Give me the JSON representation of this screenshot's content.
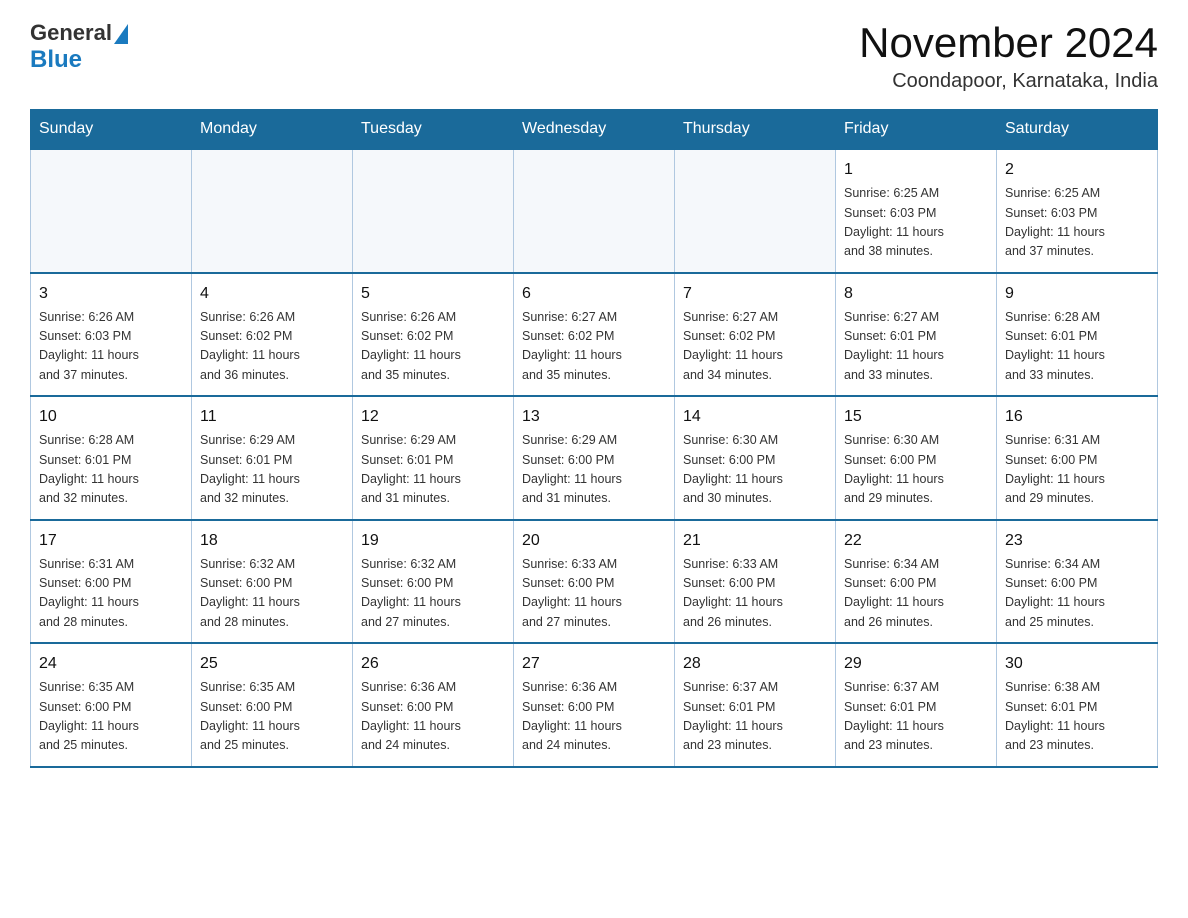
{
  "header": {
    "logo_general": "General",
    "logo_blue": "Blue",
    "title": "November 2024",
    "subtitle": "Coondapoor, Karnataka, India"
  },
  "days_of_week": [
    "Sunday",
    "Monday",
    "Tuesday",
    "Wednesday",
    "Thursday",
    "Friday",
    "Saturday"
  ],
  "weeks": [
    [
      {
        "day": "",
        "info": ""
      },
      {
        "day": "",
        "info": ""
      },
      {
        "day": "",
        "info": ""
      },
      {
        "day": "",
        "info": ""
      },
      {
        "day": "",
        "info": ""
      },
      {
        "day": "1",
        "info": "Sunrise: 6:25 AM\nSunset: 6:03 PM\nDaylight: 11 hours\nand 38 minutes."
      },
      {
        "day": "2",
        "info": "Sunrise: 6:25 AM\nSunset: 6:03 PM\nDaylight: 11 hours\nand 37 minutes."
      }
    ],
    [
      {
        "day": "3",
        "info": "Sunrise: 6:26 AM\nSunset: 6:03 PM\nDaylight: 11 hours\nand 37 minutes."
      },
      {
        "day": "4",
        "info": "Sunrise: 6:26 AM\nSunset: 6:02 PM\nDaylight: 11 hours\nand 36 minutes."
      },
      {
        "day": "5",
        "info": "Sunrise: 6:26 AM\nSunset: 6:02 PM\nDaylight: 11 hours\nand 35 minutes."
      },
      {
        "day": "6",
        "info": "Sunrise: 6:27 AM\nSunset: 6:02 PM\nDaylight: 11 hours\nand 35 minutes."
      },
      {
        "day": "7",
        "info": "Sunrise: 6:27 AM\nSunset: 6:02 PM\nDaylight: 11 hours\nand 34 minutes."
      },
      {
        "day": "8",
        "info": "Sunrise: 6:27 AM\nSunset: 6:01 PM\nDaylight: 11 hours\nand 33 minutes."
      },
      {
        "day": "9",
        "info": "Sunrise: 6:28 AM\nSunset: 6:01 PM\nDaylight: 11 hours\nand 33 minutes."
      }
    ],
    [
      {
        "day": "10",
        "info": "Sunrise: 6:28 AM\nSunset: 6:01 PM\nDaylight: 11 hours\nand 32 minutes."
      },
      {
        "day": "11",
        "info": "Sunrise: 6:29 AM\nSunset: 6:01 PM\nDaylight: 11 hours\nand 32 minutes."
      },
      {
        "day": "12",
        "info": "Sunrise: 6:29 AM\nSunset: 6:01 PM\nDaylight: 11 hours\nand 31 minutes."
      },
      {
        "day": "13",
        "info": "Sunrise: 6:29 AM\nSunset: 6:00 PM\nDaylight: 11 hours\nand 31 minutes."
      },
      {
        "day": "14",
        "info": "Sunrise: 6:30 AM\nSunset: 6:00 PM\nDaylight: 11 hours\nand 30 minutes."
      },
      {
        "day": "15",
        "info": "Sunrise: 6:30 AM\nSunset: 6:00 PM\nDaylight: 11 hours\nand 29 minutes."
      },
      {
        "day": "16",
        "info": "Sunrise: 6:31 AM\nSunset: 6:00 PM\nDaylight: 11 hours\nand 29 minutes."
      }
    ],
    [
      {
        "day": "17",
        "info": "Sunrise: 6:31 AM\nSunset: 6:00 PM\nDaylight: 11 hours\nand 28 minutes."
      },
      {
        "day": "18",
        "info": "Sunrise: 6:32 AM\nSunset: 6:00 PM\nDaylight: 11 hours\nand 28 minutes."
      },
      {
        "day": "19",
        "info": "Sunrise: 6:32 AM\nSunset: 6:00 PM\nDaylight: 11 hours\nand 27 minutes."
      },
      {
        "day": "20",
        "info": "Sunrise: 6:33 AM\nSunset: 6:00 PM\nDaylight: 11 hours\nand 27 minutes."
      },
      {
        "day": "21",
        "info": "Sunrise: 6:33 AM\nSunset: 6:00 PM\nDaylight: 11 hours\nand 26 minutes."
      },
      {
        "day": "22",
        "info": "Sunrise: 6:34 AM\nSunset: 6:00 PM\nDaylight: 11 hours\nand 26 minutes."
      },
      {
        "day": "23",
        "info": "Sunrise: 6:34 AM\nSunset: 6:00 PM\nDaylight: 11 hours\nand 25 minutes."
      }
    ],
    [
      {
        "day": "24",
        "info": "Sunrise: 6:35 AM\nSunset: 6:00 PM\nDaylight: 11 hours\nand 25 minutes."
      },
      {
        "day": "25",
        "info": "Sunrise: 6:35 AM\nSunset: 6:00 PM\nDaylight: 11 hours\nand 25 minutes."
      },
      {
        "day": "26",
        "info": "Sunrise: 6:36 AM\nSunset: 6:00 PM\nDaylight: 11 hours\nand 24 minutes."
      },
      {
        "day": "27",
        "info": "Sunrise: 6:36 AM\nSunset: 6:00 PM\nDaylight: 11 hours\nand 24 minutes."
      },
      {
        "day": "28",
        "info": "Sunrise: 6:37 AM\nSunset: 6:01 PM\nDaylight: 11 hours\nand 23 minutes."
      },
      {
        "day": "29",
        "info": "Sunrise: 6:37 AM\nSunset: 6:01 PM\nDaylight: 11 hours\nand 23 minutes."
      },
      {
        "day": "30",
        "info": "Sunrise: 6:38 AM\nSunset: 6:01 PM\nDaylight: 11 hours\nand 23 minutes."
      }
    ]
  ]
}
